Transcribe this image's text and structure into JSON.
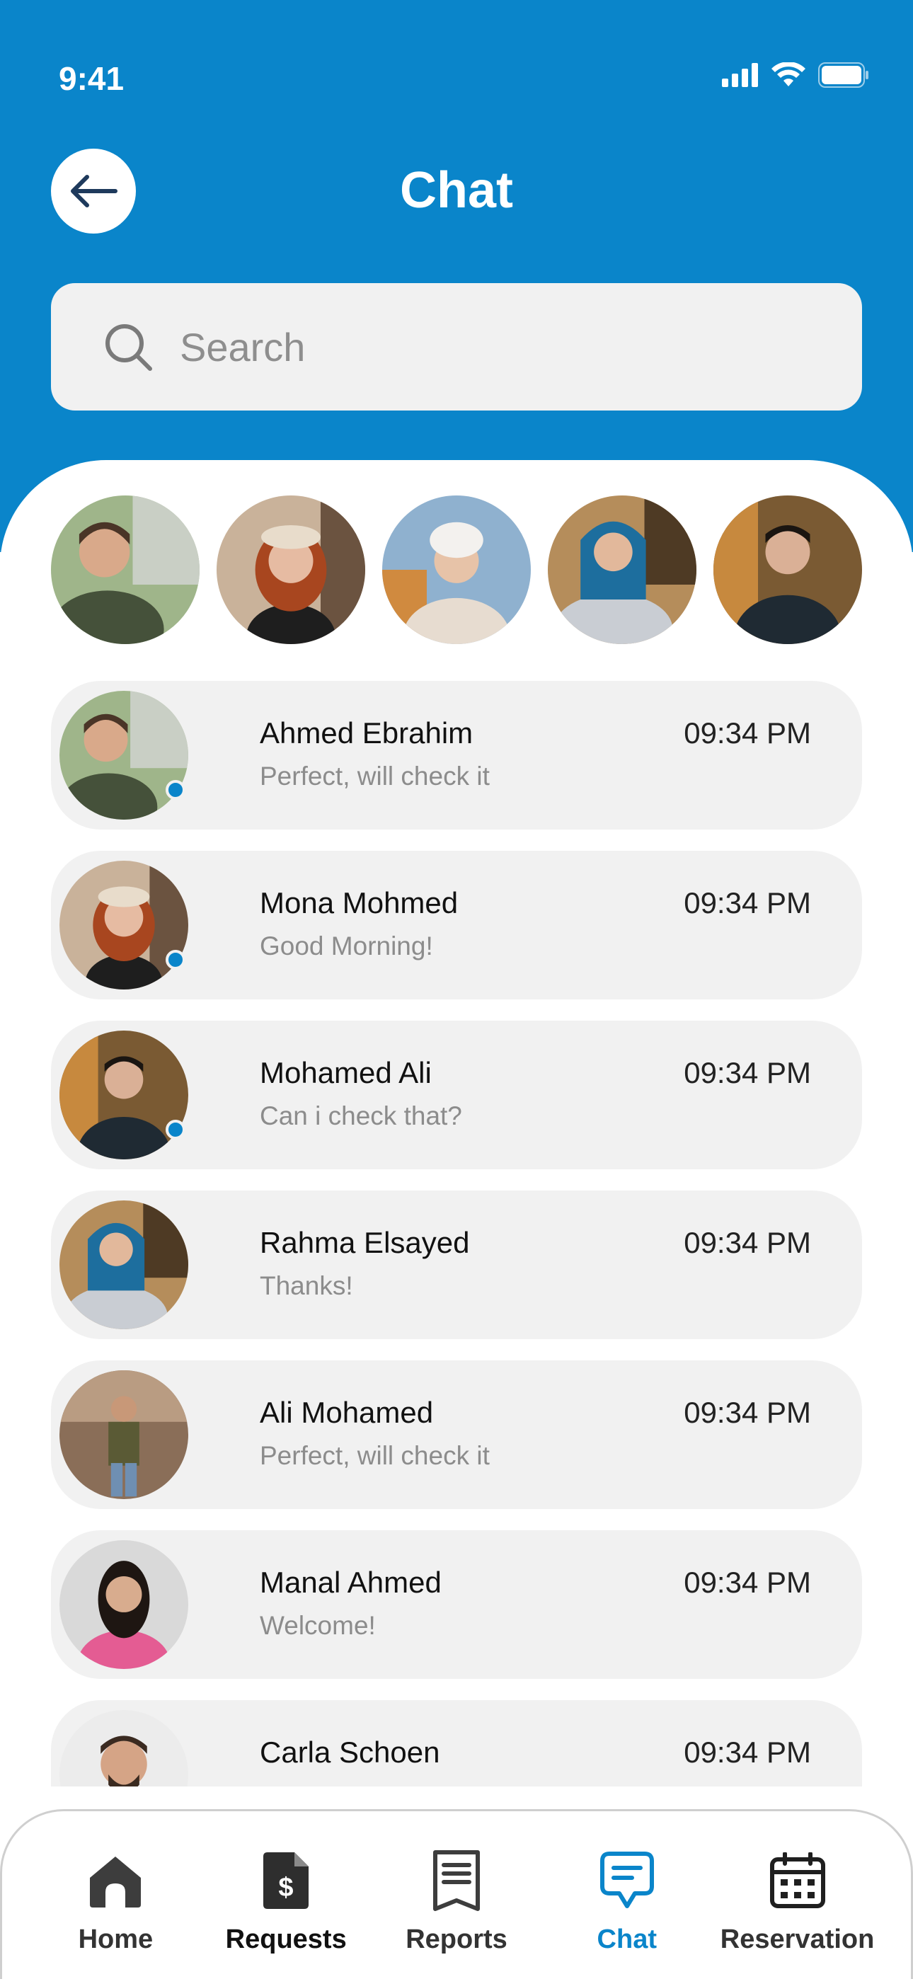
{
  "status_bar": {
    "time": "9:41"
  },
  "header": {
    "title": "Chat"
  },
  "search": {
    "placeholder": "Search"
  },
  "stories": [
    {
      "name": "story-1"
    },
    {
      "name": "story-2"
    },
    {
      "name": "story-3"
    },
    {
      "name": "story-4"
    },
    {
      "name": "story-5"
    }
  ],
  "chats": [
    {
      "name": "Ahmed Ebrahim",
      "message": "Perfect, will check it",
      "time": "09:34 PM",
      "online": true
    },
    {
      "name": "Mona Mohmed",
      "message": "Good Morning!",
      "time": "09:34 PM",
      "online": true
    },
    {
      "name": "Mohamed Ali",
      "message": "Can i check that?",
      "time": "09:34 PM",
      "online": true
    },
    {
      "name": "Rahma Elsayed",
      "message": "Thanks!",
      "time": "09:34 PM",
      "online": false
    },
    {
      "name": "Ali Mohamed",
      "message": "Perfect, will check it",
      "time": "09:34 PM",
      "online": false
    },
    {
      "name": "Manal Ahmed",
      "message": "Welcome!",
      "time": "09:34 PM",
      "online": false
    },
    {
      "name": "Carla Schoen",
      "message": "",
      "time": "09:34 PM",
      "online": false
    }
  ],
  "tabs": [
    {
      "label": "Home",
      "icon": "home-icon"
    },
    {
      "label": "Requests",
      "icon": "requests-icon"
    },
    {
      "label": "Reports",
      "icon": "reports-icon"
    },
    {
      "label": "Chat",
      "icon": "chat-icon",
      "active": true
    },
    {
      "label": "Reservation",
      "icon": "calendar-icon"
    }
  ],
  "colors": {
    "accent": "#0A85CA",
    "card": "#F1F1F1"
  }
}
